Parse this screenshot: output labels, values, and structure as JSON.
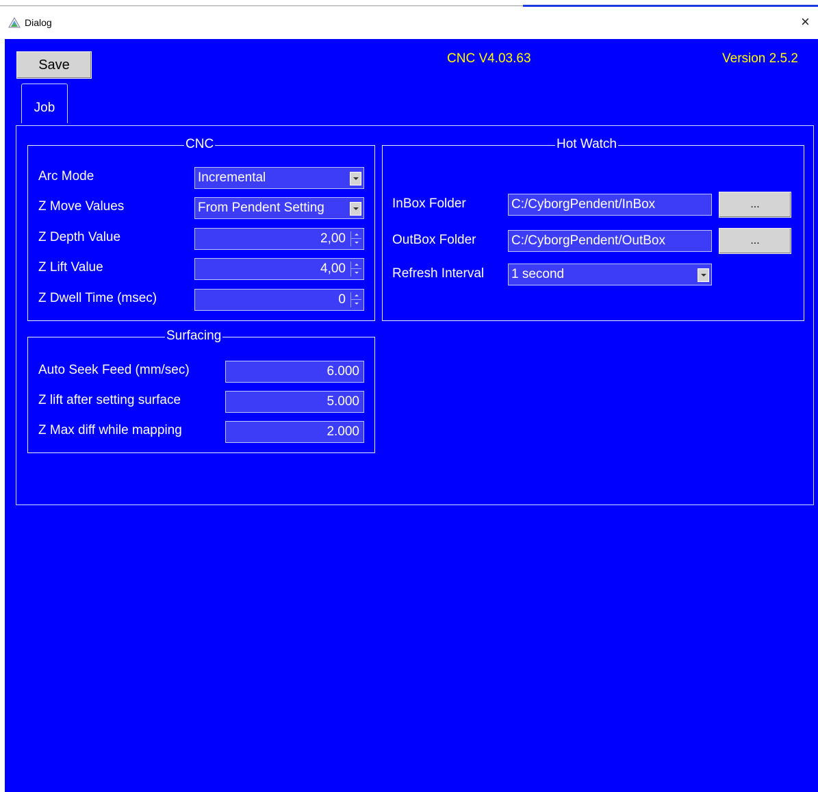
{
  "window": {
    "title": "Dialog",
    "close_glyph": "×",
    "app_icon": "dialog-app-icon"
  },
  "header": {
    "save_label": "Save",
    "cnc_version": "CNC V4.03.63",
    "app_version": "Version 2.5.2"
  },
  "tabs": [
    {
      "label": "Job",
      "selected": true
    }
  ],
  "cnc": {
    "title": "CNC",
    "arc_mode": {
      "label": "Arc Mode",
      "value": "Incremental"
    },
    "z_move_values": {
      "label": "Z Move Values",
      "value": "From Pendent Setting"
    },
    "z_depth": {
      "label": "Z Depth Value",
      "value": "2,00"
    },
    "z_lift": {
      "label": "Z Lift Value",
      "value": "4,00"
    },
    "z_dwell": {
      "label": "Z Dwell Time (msec)",
      "value": "0"
    }
  },
  "surfacing": {
    "title": "Surfacing",
    "auto_seek_feed": {
      "label": "Auto Seek Feed (mm/sec)",
      "value": "6.000"
    },
    "z_lift_after": {
      "label": "Z lift after setting surface",
      "value": "5.000"
    },
    "z_max_diff": {
      "label": "Z Max diff while mapping",
      "value": "2.000"
    }
  },
  "hot_watch": {
    "title": "Hot Watch",
    "inbox": {
      "label": "InBox Folder",
      "value": "C:/CyborgPendent/InBox",
      "browse_label": "..."
    },
    "outbox": {
      "label": "OutBox Folder",
      "value": "C:/CyborgPendent/OutBox",
      "browse_label": "..."
    },
    "refresh": {
      "label": "Refresh Interval",
      "value": "1 second"
    }
  },
  "colors": {
    "background": "#0000ff",
    "field": "#3d3df8",
    "header_text": "#ffff00",
    "button": "#d4d4d4"
  }
}
